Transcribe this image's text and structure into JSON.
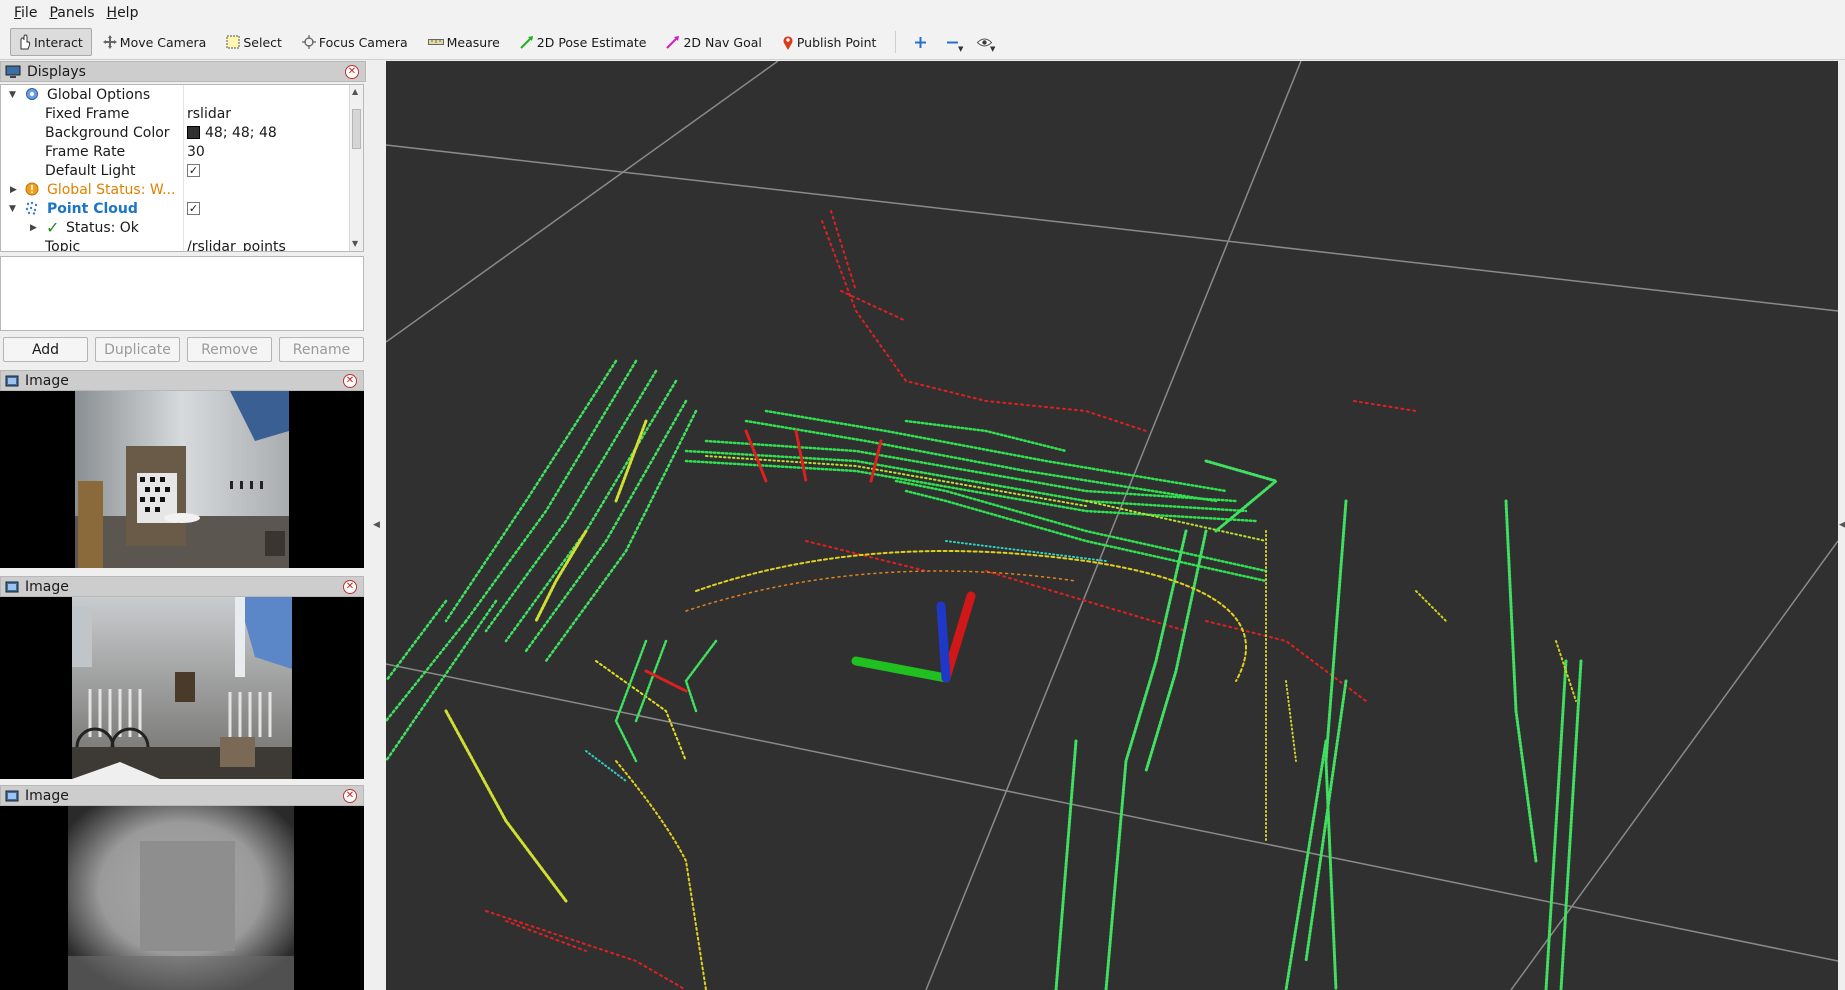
{
  "menu": [
    {
      "label": "File",
      "mnemonic": "F",
      "rest": "ile"
    },
    {
      "label": "Panels",
      "mnemonic": "P",
      "rest": "anels"
    },
    {
      "label": "Help",
      "mnemonic": "H",
      "rest": "elp"
    }
  ],
  "toolbar": {
    "interact": "Interact",
    "move_camera": "Move Camera",
    "select": "Select",
    "focus_camera": "Focus Camera",
    "measure": "Measure",
    "pose_estimate": "2D Pose Estimate",
    "nav_goal": "2D Nav Goal",
    "publish_point": "Publish Point"
  },
  "displays": {
    "title": "Displays",
    "rows": {
      "global_options": "Global Options",
      "fixed_frame_label": "Fixed Frame",
      "fixed_frame_value": "rslidar",
      "bg_color_label": "Background Color",
      "bg_color_value": "48; 48; 48",
      "frame_rate_label": "Frame Rate",
      "frame_rate_value": "30",
      "default_light_label": "Default Light",
      "default_light_checked": "✓",
      "global_status": "Global Status: W...",
      "point_cloud": "Point Cloud",
      "point_cloud_checked": "✓",
      "status_ok": "Status: Ok",
      "topic_label": "Topic",
      "topic_value": "/rslidar_points"
    },
    "buttons": {
      "add": "Add",
      "duplicate": "Duplicate",
      "remove": "Remove",
      "rename": "Rename"
    }
  },
  "image_panels": [
    {
      "title": "Image"
    },
    {
      "title": "Image"
    },
    {
      "title": "Image"
    }
  ],
  "colors": {
    "background": "#303030",
    "axis_x": "#e02020",
    "axis_y": "#20c020",
    "axis_z": "#2040d0",
    "warning": "#e08000",
    "point_cloud_label": "#1c74c8"
  }
}
